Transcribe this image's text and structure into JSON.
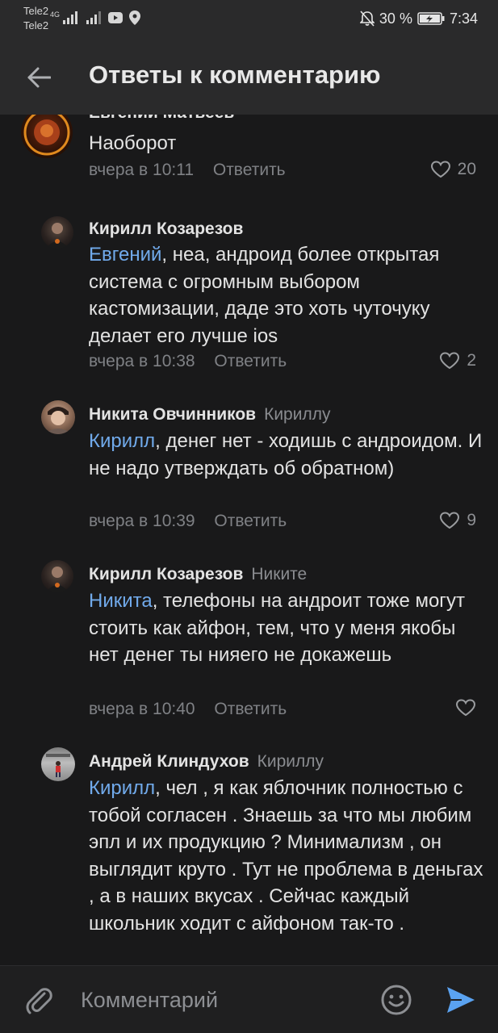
{
  "status_bar": {
    "carrier_1": "Tele2",
    "carrier_2": "Tele2",
    "network": "4G",
    "battery": "30 %",
    "time": "7:34"
  },
  "header": {
    "title": "Ответы к комментарию"
  },
  "comments": [
    {
      "author": "Евгений Матвеев",
      "reply_to": "",
      "mention": "",
      "text": "Наоборот",
      "time": "вчера в 10:11",
      "reply_label": "Ответить",
      "likes": "20"
    },
    {
      "author": "Кирилл Козарезов",
      "reply_to": "",
      "mention": "Евгений",
      "text": ", неа, андроид более открытая система с огромным выбором кастомизации, даде это хоть чуточуку делает его лучше ios",
      "time": "вчера в 10:38",
      "reply_label": "Ответить",
      "likes": "2"
    },
    {
      "author": "Никита Овчинников",
      "reply_to": "Кириллу",
      "mention": "Кирилл",
      "text": ", денег нет - ходишь с андроидом. И не надо утверждать об обратном)",
      "time": "вчера в 10:39",
      "reply_label": "Ответить",
      "likes": "9"
    },
    {
      "author": "Кирилл Козарезов",
      "reply_to": "Никите",
      "mention": "Никита",
      "text": ", телефоны на андроит тоже могут стоить как айфон, тем, что у меня якобы нет денег ты нияего не докажешь",
      "time": "вчера в 10:40",
      "reply_label": "Ответить",
      "likes": ""
    },
    {
      "author": "Андрей Клиндухов",
      "reply_to": "Кириллу",
      "mention": "Кирилл",
      "text": ", чел , я как яблочник полностью с тобой согласен . Знаешь за что мы любим эпл и их продукцию ? Минимализм , он выглядит круто . Тут не проблема в деньгах , а в наших вкусах . Сейчас каждый школьник ходит с айфоном так-то ."
    }
  ],
  "input": {
    "placeholder": "Комментарий"
  },
  "icons": {
    "back": "arrow-left-icon",
    "like": "heart-icon",
    "attach": "paperclip-icon",
    "emoji": "smile-icon",
    "send": "send-icon"
  },
  "colors": {
    "background": "#19191a",
    "header": "#2a2a2b",
    "accent": "#71aaeb",
    "send": "#5aa2f0",
    "secondary_text": "#7f8185"
  }
}
